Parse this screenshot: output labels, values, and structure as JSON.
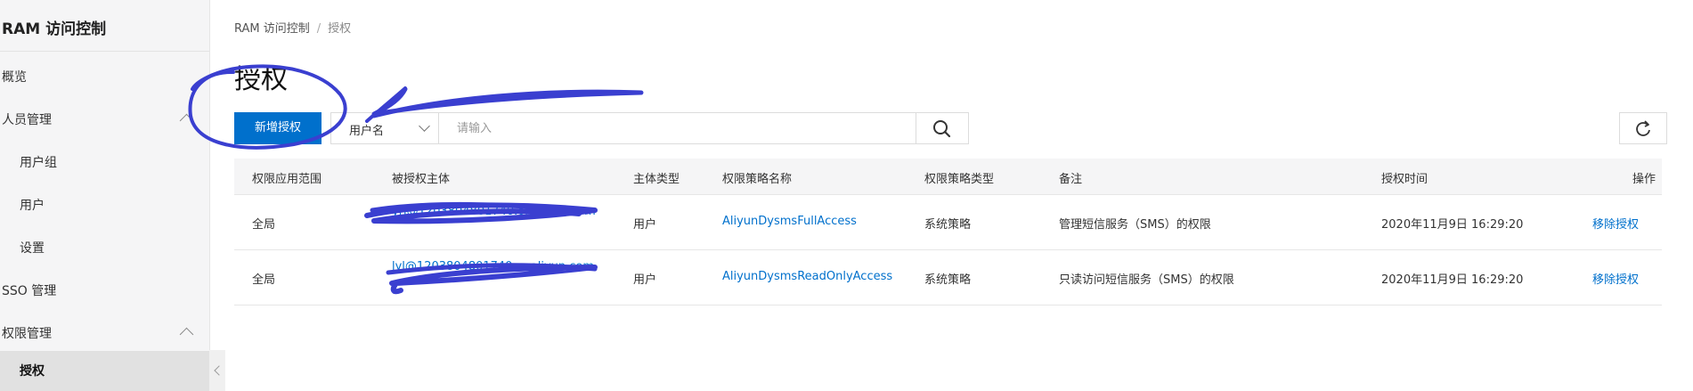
{
  "sidebar": {
    "title": "RAM 访问控制",
    "items": [
      {
        "label": "概览"
      },
      {
        "label": "人员管理"
      },
      {
        "label": "用户组"
      },
      {
        "label": "用户"
      },
      {
        "label": "设置"
      },
      {
        "label": "SSO 管理"
      },
      {
        "label": "权限管理"
      },
      {
        "label": "授权"
      }
    ]
  },
  "breadcrumb": {
    "root": "RAM 访问控制",
    "separator": "/",
    "current": "授权"
  },
  "page": {
    "title": "授权"
  },
  "toolbar": {
    "add_label": "新增授权",
    "filter_selected": "用户名",
    "search_placeholder": "请输入"
  },
  "table": {
    "columns": [
      "权限应用范围",
      "被授权主体",
      "主体类型",
      "权限策略名称",
      "权限策略类型",
      "备注",
      "授权时间",
      "操作"
    ],
    "rows": [
      {
        "scope": "全局",
        "subject": "yri@1203804801740.onaliyun.com",
        "subject_type": "用户",
        "policy_name": "AliyunDysmsFullAccess",
        "policy_type": "系统策略",
        "note": "管理短信服务（SMS）的权限",
        "time": "2020年11月9日 16:29:20",
        "action": "移除授权"
      },
      {
        "scope": "全局",
        "subject": "lyl@1203804801740.onaliyun.com",
        "subject_type": "用户",
        "policy_name": "AliyunDysmsReadOnlyAccess",
        "policy_type": "系统策略",
        "note": "只读访问短信服务（SMS）的权限",
        "time": "2020年11月9日 16:29:20",
        "action": "移除授权"
      }
    ]
  },
  "colors": {
    "primary": "#0070cc",
    "accent": "#ff6a00",
    "annotation": "#3a3fd0"
  }
}
